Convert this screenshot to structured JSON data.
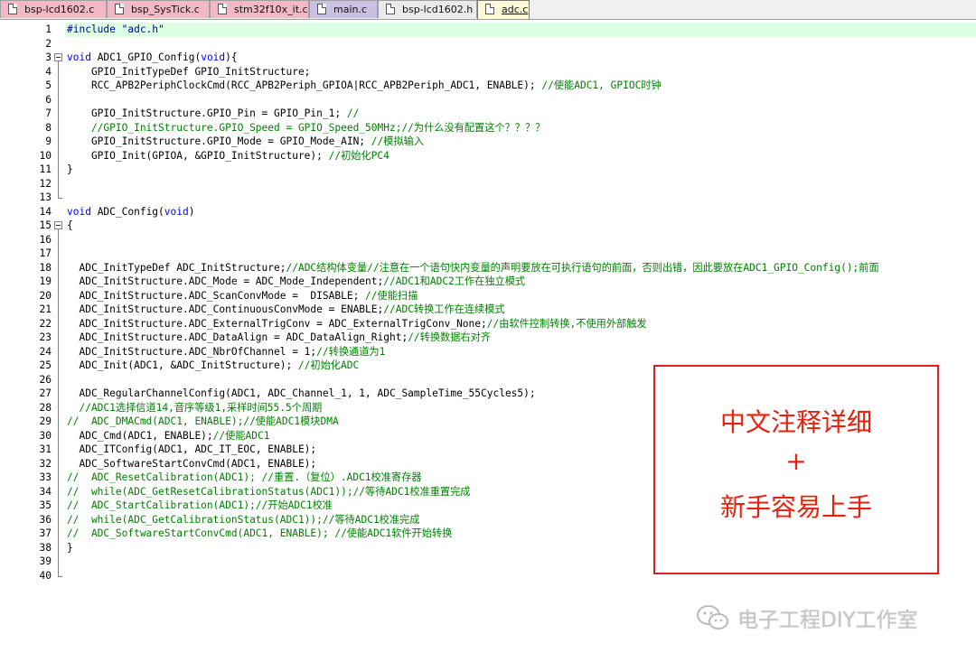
{
  "tabs": [
    {
      "label": "bsp-lcd1602.c",
      "color": "#f3b8c6"
    },
    {
      "label": "bsp_SysTick.c",
      "color": "#f3b8c6"
    },
    {
      "label": "stm32f10x_it.c",
      "color": "#f3b8c6"
    },
    {
      "label": "main.c",
      "color": "#c9c0e4"
    },
    {
      "label": "bsp-lcd1602.h",
      "color": "#eaeaea"
    },
    {
      "label": "adc.c",
      "color": "#fff9d6"
    }
  ],
  "active_tab": "adc.c",
  "code_lines": [
    {
      "n": "1",
      "segs": [
        {
          "t": "#include \"adc.h\"",
          "c": "pp"
        }
      ]
    },
    {
      "n": "2",
      "segs": []
    },
    {
      "n": "3",
      "segs": [
        {
          "t": "void",
          "c": "kw"
        },
        {
          "t": " ADC1_GPIO_Config("
        },
        {
          "t": "void",
          "c": "kw"
        },
        {
          "t": "){"
        }
      ]
    },
    {
      "n": "4",
      "segs": [
        {
          "t": "    GPIO_InitTypeDef GPIO_InitStructure;"
        }
      ]
    },
    {
      "n": "5",
      "segs": [
        {
          "t": "    RCC_APB2PeriphClockCmd(RCC_APB2Periph_GPIOA|RCC_APB2Periph_ADC1, ENABLE); "
        },
        {
          "t": "//使能ADC1, GPIOC时钟",
          "c": "cm"
        }
      ]
    },
    {
      "n": "6",
      "segs": []
    },
    {
      "n": "7",
      "segs": [
        {
          "t": "    GPIO_InitStructure.GPIO_Pin = GPIO_Pin_1; "
        },
        {
          "t": "//",
          "c": "cm"
        }
      ]
    },
    {
      "n": "8",
      "segs": [
        {
          "t": "    //GPIO_InitStructure.GPIO_Speed = GPIO_Speed_50MHz;//为什么没有配置这个？？？？",
          "c": "cm"
        }
      ]
    },
    {
      "n": "9",
      "segs": [
        {
          "t": "    GPIO_InitStructure.GPIO_Mode = GPIO_Mode_AIN; "
        },
        {
          "t": "//模拟输入",
          "c": "cm"
        }
      ]
    },
    {
      "n": "10",
      "segs": [
        {
          "t": "    GPIO_Init(GPIOA, &GPIO_InitStructure); "
        },
        {
          "t": "//初始化PC4",
          "c": "cm"
        }
      ]
    },
    {
      "n": "11",
      "segs": [
        {
          "t": "}"
        }
      ]
    },
    {
      "n": "12",
      "segs": []
    },
    {
      "n": "13",
      "segs": []
    },
    {
      "n": "14",
      "segs": [
        {
          "t": "void",
          "c": "kw"
        },
        {
          "t": " ADC_Config("
        },
        {
          "t": "void",
          "c": "kw"
        },
        {
          "t": ")"
        }
      ]
    },
    {
      "n": "15",
      "segs": [
        {
          "t": "{"
        }
      ]
    },
    {
      "n": "16",
      "segs": []
    },
    {
      "n": "17",
      "segs": []
    },
    {
      "n": "18",
      "segs": [
        {
          "t": "  ADC_InitTypeDef ADC_InitStructure;"
        },
        {
          "t": "//ADC结构体变量//注意在一个语句快内变量的声明要放在可执行语句的前面，否则出错，因此要放在ADC1_GPIO_Config();前面",
          "c": "cm"
        }
      ]
    },
    {
      "n": "19",
      "segs": [
        {
          "t": "  ADC_InitStructure.ADC_Mode = ADC_Mode_Independent;"
        },
        {
          "t": "//ADC1和ADC2工作在独立模式",
          "c": "cm"
        }
      ]
    },
    {
      "n": "20",
      "segs": [
        {
          "t": "  ADC_InitStructure.ADC_ScanConvMode =  DISABLE; "
        },
        {
          "t": "//使能扫描",
          "c": "cm"
        }
      ]
    },
    {
      "n": "21",
      "segs": [
        {
          "t": "  ADC_InitStructure.ADC_ContinuousConvMode = ENABLE;"
        },
        {
          "t": "//ADC转换工作在连续模式",
          "c": "cm"
        }
      ]
    },
    {
      "n": "22",
      "segs": [
        {
          "t": "  ADC_InitStructure.ADC_ExternalTrigConv = ADC_ExternalTrigConv_None;"
        },
        {
          "t": "//由软件控制转换,不使用外部触发",
          "c": "cm"
        }
      ]
    },
    {
      "n": "23",
      "segs": [
        {
          "t": "  ADC_InitStructure.ADC_DataAlign = ADC_DataAlign_Right;"
        },
        {
          "t": "//转换数据右对齐",
          "c": "cm"
        }
      ]
    },
    {
      "n": "24",
      "segs": [
        {
          "t": "  ADC_InitStructure.ADC_NbrOfChannel = 1;"
        },
        {
          "t": "//转换通道为1",
          "c": "cm"
        }
      ]
    },
    {
      "n": "25",
      "segs": [
        {
          "t": "  ADC_Init(ADC1, &ADC_InitStructure); "
        },
        {
          "t": "//初始化ADC",
          "c": "cm"
        }
      ]
    },
    {
      "n": "26",
      "segs": []
    },
    {
      "n": "27",
      "segs": [
        {
          "t": "  ADC_RegularChannelConfig(ADC1, ADC_Channel_1, 1, ADC_SampleTime_55Cycles5);"
        }
      ]
    },
    {
      "n": "28",
      "segs": [
        {
          "t": "  //ADC1选择信道14,音序等级1,采样时间55.5个周期",
          "c": "cm"
        }
      ]
    },
    {
      "n": "29",
      "segs": [
        {
          "t": "//  ADC_DMACmd(ADC1, ENABLE);//使能ADC1模块DMA",
          "c": "cm"
        }
      ]
    },
    {
      "n": "30",
      "segs": [
        {
          "t": "  ADC_Cmd(ADC1, ENABLE);"
        },
        {
          "t": "//使能ADC1",
          "c": "cm"
        }
      ]
    },
    {
      "n": "31",
      "segs": [
        {
          "t": "  ADC_ITConfig(ADC1, ADC_IT_EOC, ENABLE);"
        }
      ]
    },
    {
      "n": "32",
      "segs": [
        {
          "t": "  ADC_SoftwareStartConvCmd(ADC1, ENABLE);"
        }
      ]
    },
    {
      "n": "33",
      "segs": [
        {
          "t": "//  ADC_ResetCalibration(ADC1); //重置.（复位）.ADC1校准寄存器",
          "c": "cm"
        }
      ]
    },
    {
      "n": "34",
      "segs": [
        {
          "t": "//  while(ADC_GetResetCalibrationStatus(ADC1));//等待ADC1校准重置完成",
          "c": "cm"
        }
      ]
    },
    {
      "n": "35",
      "segs": [
        {
          "t": "//  ADC_StartCalibration(ADC1);//开始ADC1校准",
          "c": "cm"
        }
      ]
    },
    {
      "n": "36",
      "segs": [
        {
          "t": "//  while(ADC_GetCalibrationStatus(ADC1));//等待ADC1校准完成",
          "c": "cm"
        }
      ]
    },
    {
      "n": "37",
      "segs": [
        {
          "t": "//  ADC_SoftwareStartConvCmd(ADC1, ENABLE); //使能ADC1软件开始转换",
          "c": "cm"
        }
      ]
    },
    {
      "n": "38",
      "segs": [
        {
          "t": "}"
        }
      ]
    },
    {
      "n": "39",
      "segs": []
    },
    {
      "n": "40",
      "segs": []
    }
  ],
  "annotation": {
    "line1": "中文注释详细",
    "plus": "+",
    "line2": "新手容易上手"
  },
  "watermark": {
    "icon": "wechat-icon",
    "text": "电子工程DIY工作室"
  },
  "colors": {
    "keyword": "#0000ff",
    "comment": "#008000",
    "preprocessor": "#0000a0",
    "current_line": "#dcffe3",
    "annotation": "#e8200c"
  }
}
